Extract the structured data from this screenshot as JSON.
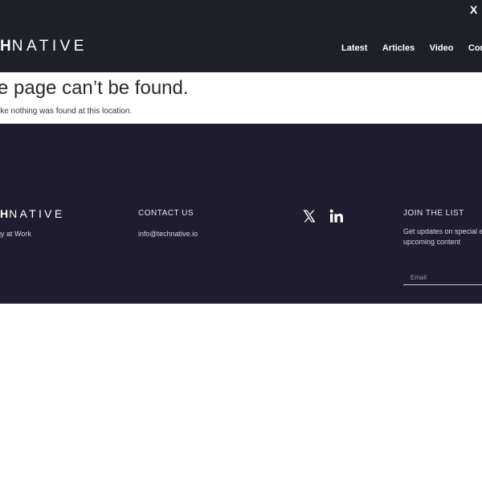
{
  "header": {
    "logo_bold": "H",
    "logo_light": "NATIVE",
    "close_label": "X",
    "nav": [
      {
        "label": "Latest"
      },
      {
        "label": "Articles"
      },
      {
        "label": "Video"
      },
      {
        "label": "Contribu"
      }
    ]
  },
  "main": {
    "title": "e page can’t be found.",
    "subtitle": "ike nothing was found at this location."
  },
  "footer": {
    "logo_bold": "H",
    "logo_light": "NATIVE",
    "tagline": "gy at Work",
    "contact_heading": "CONTACT US",
    "contact_email": "info@technative.io",
    "social": [
      {
        "icon": "x-icon"
      },
      {
        "icon": "linkedin-icon"
      }
    ],
    "join_heading": "JOIN THE LIST",
    "join_text": "Get updates on special e upcoming content",
    "email_placeholder": "Email"
  },
  "colors": {
    "header_bg": "#1d202a",
    "footer_bg": "#201c2f",
    "text_dark": "#2a2a2a"
  }
}
